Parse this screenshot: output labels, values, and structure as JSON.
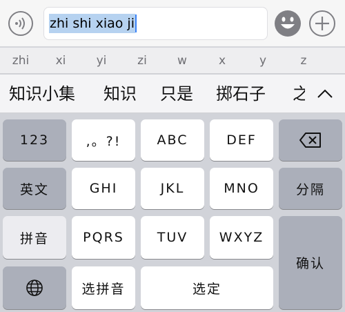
{
  "input": {
    "text": "zhi shi xiao ji"
  },
  "pinyin_options": [
    "zhi",
    "xi",
    "yi",
    "zi",
    "w",
    "x",
    "y",
    "z"
  ],
  "candidates": [
    "知识小集",
    "知识",
    "只是",
    "掷石子",
    "之"
  ],
  "keys": {
    "numbers": "123",
    "punct": ",。?!",
    "abc": "ABC",
    "def": "DEF",
    "english": "英文",
    "ghi": "GHI",
    "jkl": "JKL",
    "mno": "MNO",
    "separator": "分隔",
    "pinyin": "拼音",
    "pqrs": "PQRS",
    "tuv": "TUV",
    "wxyz": "WXYZ",
    "confirm": "确认",
    "select_pinyin": "选拼音",
    "select": "选定"
  },
  "icons": {
    "voice": "voice-wave-icon",
    "emoji": "emoji-icon",
    "add": "plus-icon",
    "collapse": "chevron-up-icon",
    "delete": "backspace-icon",
    "globe": "globe-icon"
  },
  "colors": {
    "selection": "#b6d2f0",
    "caret": "#3b82f6",
    "key_light": "#ffffff",
    "key_dark": "#abafba",
    "keyboard_bg": "#d1d3d9"
  }
}
